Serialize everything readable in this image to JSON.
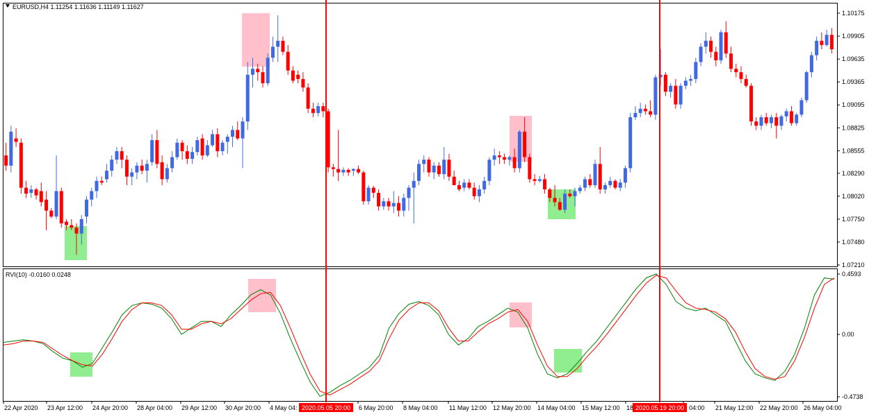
{
  "colors": {
    "bull": "#4169e1",
    "bear": "#ff0000",
    "rvi_main": "#008000",
    "rvi_signal": "#ff0000",
    "pink_box": "#ffc0cb",
    "green_box": "#90ee90",
    "vline": "#ff0000",
    "axis_highlight_bg": "#ff0000"
  },
  "main_pane": {
    "symbol_header": "EURUSD,H4  1.11254 1.11636 1.11149 1.11627",
    "header_icon": "dropdown-triangle-icon",
    "price_labels": [
      "1.10175",
      "1.09905",
      "1.09635",
      "1.09365",
      "1.09095",
      "1.08825",
      "1.08555",
      "1.08290",
      "1.08020",
      "1.07750",
      "1.07480",
      "1.07210"
    ]
  },
  "rvi_pane": {
    "header": "RVI(10) -0.0160 0.0248",
    "scale_labels": [
      "0.4593",
      "0.00",
      "-0.4738"
    ]
  },
  "time_axis": {
    "labels": [
      "22 Apr 2020",
      "23 Apr 12:00",
      "24 Apr 20:00",
      "28 Apr 04:00",
      "29 Apr 12:00",
      "30 Apr 20:00",
      "4 May 04:",
      "6 May 20:00",
      "8 May 04:00",
      "11 May 12:00",
      "12 May 20:00",
      "14 May 04:00",
      "15 May 12:00",
      "18",
      "y 04:00",
      "21 May 12:00",
      "22 May 20:00",
      "26 May 04:00"
    ],
    "highlight_1": "2020.05.05 20:00",
    "highlight_2": "2020.05.19 20:00"
  },
  "chart_data": [
    {
      "type": "candlestick",
      "symbol": "EURUSD",
      "timeframe": "H4",
      "ylim": [
        1.0721,
        1.10175
      ],
      "last_ohlc": {
        "open": 1.11254,
        "high": 1.11636,
        "low": 1.11149,
        "close": 1.11627
      },
      "candles": [
        [
          1.085,
          1.0865,
          1.0832,
          1.0838
        ],
        [
          1.0838,
          1.0885,
          1.083,
          1.0878
        ],
        [
          1.087,
          1.0882,
          1.086,
          1.0866
        ],
        [
          1.0865,
          1.087,
          1.0805,
          1.0812
        ],
        [
          1.0812,
          1.082,
          1.08,
          1.0805
        ],
        [
          1.0806,
          1.0815,
          1.08,
          1.081
        ],
        [
          1.081,
          1.0812,
          1.0798,
          1.0803
        ],
        [
          1.0808,
          1.0818,
          1.079,
          1.0795
        ],
        [
          1.0798,
          1.0808,
          1.0762,
          1.0785
        ],
        [
          1.0785,
          1.0788,
          1.0776,
          1.0778
        ],
        [
          1.0778,
          1.085,
          1.0775,
          1.0808
        ],
        [
          1.0808,
          1.0812,
          1.0765,
          1.077
        ],
        [
          1.0772,
          1.0775,
          1.0762,
          1.0768
        ],
        [
          1.0768,
          1.0775,
          1.0762,
          1.0765
        ],
        [
          1.0765,
          1.077,
          1.0733,
          1.0758
        ],
        [
          1.0758,
          1.078,
          1.0745,
          1.0775
        ],
        [
          1.0778,
          1.0802,
          1.077,
          1.0798
        ],
        [
          1.0798,
          1.0812,
          1.079,
          1.0808
        ],
        [
          1.0808,
          1.0825,
          1.08,
          1.082
        ],
        [
          1.082,
          1.0825,
          1.0815,
          1.0818
        ],
        [
          1.0822,
          1.084,
          1.0818,
          1.0832
        ],
        [
          1.0832,
          1.085,
          1.0825,
          1.0845
        ],
        [
          1.0845,
          1.086,
          1.084,
          1.0855
        ],
        [
          1.0855,
          1.086,
          1.0835,
          1.0845
        ],
        [
          1.0845,
          1.085,
          1.0815,
          1.0825
        ],
        [
          1.0825,
          1.0835,
          1.0815,
          1.083
        ],
        [
          1.083,
          1.0842,
          1.0822,
          1.0838
        ],
        [
          1.0838,
          1.0845,
          1.0828,
          1.0832
        ],
        [
          1.0832,
          1.0845,
          1.0818,
          1.084
        ],
        [
          1.0842,
          1.0875,
          1.0838,
          1.0868
        ],
        [
          1.0868,
          1.088,
          1.0835,
          1.084
        ],
        [
          1.0842,
          1.085,
          1.0815,
          1.0822
        ],
        [
          1.0822,
          1.084,
          1.0818,
          1.0835
        ],
        [
          1.0835,
          1.0855,
          1.083,
          1.0848
        ],
        [
          1.0848,
          1.087,
          1.0845,
          1.0865
        ],
        [
          1.0865,
          1.0868,
          1.0845,
          1.0855
        ],
        [
          1.0855,
          1.0862,
          1.084,
          1.0846
        ],
        [
          1.0846,
          1.086,
          1.084,
          1.0854
        ],
        [
          1.0854,
          1.0872,
          1.085,
          1.0868
        ],
        [
          1.087,
          1.0875,
          1.0845,
          1.085
        ],
        [
          1.085,
          1.0868,
          1.0848,
          1.0862
        ],
        [
          1.0862,
          1.088,
          1.086,
          1.0875
        ],
        [
          1.0875,
          1.0882,
          1.0848,
          1.0855
        ],
        [
          1.0855,
          1.0868,
          1.085,
          1.0865
        ],
        [
          1.0866,
          1.0875,
          1.0852,
          1.0872
        ],
        [
          1.0872,
          1.0885,
          1.086,
          1.088
        ],
        [
          1.088,
          1.089,
          1.0868,
          1.087
        ],
        [
          1.087,
          1.0895,
          1.0835,
          1.089
        ],
        [
          1.089,
          1.096,
          1.088,
          1.0945
        ],
        [
          1.0945,
          1.0965,
          1.093,
          1.0952
        ],
        [
          1.0952,
          1.0958,
          1.0938,
          1.0948
        ],
        [
          1.0948,
          1.0955,
          1.093,
          1.0935
        ],
        [
          1.0935,
          1.097,
          1.0932,
          1.0965
        ],
        [
          1.0965,
          1.099,
          1.096,
          1.0978
        ],
        [
          1.0978,
          1.1015,
          1.096,
          1.0985
        ],
        [
          1.0985,
          1.099,
          1.0968,
          1.0972
        ],
        [
          1.0972,
          1.098,
          1.0945,
          1.095
        ],
        [
          1.095,
          1.0955,
          1.0935,
          1.0938
        ],
        [
          1.0945,
          1.095,
          1.0935,
          1.094
        ],
        [
          1.094,
          1.0948,
          1.0925,
          1.093
        ],
        [
          1.093,
          1.0935,
          1.09,
          1.0905
        ],
        [
          1.0905,
          1.0912,
          1.0895,
          1.09
        ],
        [
          1.09,
          1.0912,
          1.0896,
          1.0908
        ],
        [
          1.0908,
          1.0912,
          1.0895,
          1.0902
        ],
        [
          1.0902,
          1.0905,
          1.083,
          1.0836
        ],
        [
          1.0836,
          1.084,
          1.0825,
          1.0834
        ],
        [
          1.0834,
          1.088,
          1.082,
          1.083
        ],
        [
          1.083,
          1.0836,
          1.0826,
          1.0833
        ],
        [
          1.0833,
          1.0835,
          1.0826,
          1.083
        ],
        [
          1.0832,
          1.0835,
          1.0826,
          1.0834
        ],
        [
          1.0834,
          1.0838,
          1.0828,
          1.083
        ],
        [
          1.083,
          1.0832,
          1.0792,
          1.0796
        ],
        [
          1.0796,
          1.0815,
          1.0792,
          1.0812
        ],
        [
          1.0812,
          1.0814,
          1.08,
          1.0806
        ],
        [
          1.0806,
          1.081,
          1.0785,
          1.079
        ],
        [
          1.079,
          1.08,
          1.0786,
          1.0796
        ],
        [
          1.0796,
          1.08,
          1.0785,
          1.079
        ],
        [
          1.079,
          1.0808,
          1.0782,
          1.0794
        ],
        [
          1.0794,
          1.0802,
          1.0778,
          1.0785
        ],
        [
          1.0785,
          1.0805,
          1.0778,
          1.08
        ],
        [
          1.08,
          1.0815,
          1.0785,
          1.0812
        ],
        [
          1.0812,
          1.083,
          1.077,
          1.082
        ],
        [
          1.082,
          1.0845,
          1.0815,
          1.084
        ],
        [
          1.084,
          1.085,
          1.083,
          1.0845
        ],
        [
          1.0845,
          1.0848,
          1.0825,
          1.083
        ],
        [
          1.083,
          1.0842,
          1.0822,
          1.0838
        ],
        [
          1.0838,
          1.0842,
          1.0825,
          1.0828
        ],
        [
          1.0828,
          1.086,
          1.0822,
          1.0845
        ],
        [
          1.0845,
          1.0852,
          1.082,
          1.0825
        ],
        [
          1.0825,
          1.0832,
          1.0815,
          1.0815
        ],
        [
          1.0815,
          1.082,
          1.0808,
          1.081
        ],
        [
          1.0812,
          1.0822,
          1.0808,
          1.0818
        ],
        [
          1.0818,
          1.0822,
          1.081,
          1.0812
        ],
        [
          1.0812,
          1.0818,
          1.0798,
          1.0802
        ],
        [
          1.0802,
          1.0815,
          1.0795,
          1.081
        ],
        [
          1.081,
          1.0825,
          1.0805,
          1.082
        ],
        [
          1.082,
          1.0848,
          1.0815,
          1.0845
        ],
        [
          1.0845,
          1.0858,
          1.0838,
          1.085
        ],
        [
          1.085,
          1.0855,
          1.084,
          1.0848
        ],
        [
          1.0848,
          1.0852,
          1.084,
          1.0845
        ],
        [
          1.0845,
          1.085,
          1.0838,
          1.0848
        ],
        [
          1.0848,
          1.0858,
          1.083,
          1.0835
        ],
        [
          1.0835,
          1.088,
          1.083,
          1.0878
        ],
        [
          1.0878,
          1.0895,
          1.0842,
          1.0848
        ],
        [
          1.0848,
          1.0852,
          1.0818,
          1.0822
        ],
        [
          1.0822,
          1.0828,
          1.0815,
          1.082
        ],
        [
          1.082,
          1.0826,
          1.0818,
          1.0822
        ],
        [
          1.0822,
          1.0828,
          1.0805,
          1.081
        ],
        [
          1.081,
          1.0812,
          1.0795,
          1.08
        ],
        [
          1.08,
          1.0815,
          1.079,
          1.0795
        ],
        [
          1.0795,
          1.08,
          1.0785,
          1.0786
        ],
        [
          1.0786,
          1.081,
          1.0782,
          1.0805
        ],
        [
          1.0805,
          1.081,
          1.08,
          1.0802
        ],
        [
          1.0802,
          1.0812,
          1.079,
          1.0808
        ],
        [
          1.0808,
          1.0815,
          1.0805,
          1.0812
        ],
        [
          1.0812,
          1.0825,
          1.0808,
          1.0822
        ],
        [
          1.0822,
          1.0828,
          1.0812,
          1.0815
        ],
        [
          1.0815,
          1.0845,
          1.0812,
          1.084
        ],
        [
          1.084,
          1.086,
          1.0805,
          1.081
        ],
        [
          1.081,
          1.0818,
          1.0805,
          1.0815
        ],
        [
          1.0815,
          1.0825,
          1.0812,
          1.082
        ],
        [
          1.082,
          1.0822,
          1.081,
          1.0812
        ],
        [
          1.0812,
          1.0822,
          1.0808,
          1.0818
        ],
        [
          1.0818,
          1.0838,
          1.0812,
          1.0835
        ],
        [
          1.0835,
          1.09,
          1.083,
          1.0895
        ],
        [
          1.0895,
          1.0908,
          1.0892,
          1.09
        ],
        [
          1.09,
          1.0912,
          1.0895,
          1.0905
        ],
        [
          1.0905,
          1.091,
          1.0898,
          1.0902
        ],
        [
          1.0902,
          1.0915,
          1.0895,
          1.0898
        ],
        [
          1.0898,
          1.0945,
          1.0892,
          1.0942
        ],
        [
          1.0942,
          1.0975,
          1.0932,
          1.0945
        ],
        [
          1.0945,
          1.0948,
          1.092,
          1.0925
        ],
        [
          1.0925,
          1.0935,
          1.0918,
          1.0932
        ],
        [
          1.0932,
          1.094,
          1.0905,
          1.091
        ],
        [
          1.091,
          1.0935,
          1.0905,
          1.0932
        ],
        [
          1.0932,
          1.0942,
          1.0928,
          1.0938
        ],
        [
          1.0938,
          1.0945,
          1.0932,
          1.094
        ],
        [
          1.094,
          1.0965,
          1.0935,
          1.096
        ],
        [
          1.096,
          1.0982,
          1.0955,
          1.0978
        ],
        [
          1.0978,
          1.0995,
          1.097,
          1.0985
        ],
        [
          1.0985,
          1.099,
          1.0965,
          1.0972
        ],
        [
          1.0972,
          1.0978,
          1.0955,
          1.0962
        ],
        [
          1.0962,
          1.0998,
          1.0958,
          1.0995
        ],
        [
          1.0995,
          1.1008,
          1.0965,
          1.097
        ],
        [
          1.097,
          1.0978,
          1.0948,
          1.0952
        ],
        [
          1.0952,
          1.0958,
          1.0942,
          1.0948
        ],
        [
          1.0948,
          1.0955,
          1.0935,
          1.094
        ],
        [
          1.094,
          1.0945,
          1.093,
          1.0932
        ],
        [
          1.0932,
          1.0935,
          1.0885,
          1.089
        ],
        [
          1.089,
          1.0895,
          1.088,
          1.0885
        ],
        [
          1.0885,
          1.0898,
          1.088,
          1.0895
        ],
        [
          1.0895,
          1.09,
          1.0885,
          1.0888
        ],
        [
          1.0888,
          1.0898,
          1.0882,
          1.0895
        ],
        [
          1.0895,
          1.09,
          1.087,
          1.0885
        ],
        [
          1.0885,
          1.0898,
          1.088,
          1.0896
        ],
        [
          1.0896,
          1.0905,
          1.089,
          1.0902
        ],
        [
          1.0902,
          1.0908,
          1.0885,
          1.0888
        ],
        [
          1.0888,
          1.09,
          1.0885,
          1.0898
        ],
        [
          1.0898,
          1.0918,
          1.0895,
          1.0915
        ],
        [
          1.0915,
          1.095,
          1.0912,
          1.0948
        ],
        [
          1.0948,
          1.0972,
          1.0942,
          1.0968
        ],
        [
          1.0968,
          1.099,
          1.0962,
          1.0985
        ],
        [
          1.0985,
          1.0995,
          1.0975,
          1.098
        ],
        [
          1.098,
          1.0998,
          1.0978,
          1.0992
        ],
        [
          1.0992,
          1.1,
          1.097,
          1.0975
        ]
      ]
    },
    {
      "type": "line",
      "title": "RVI(10)",
      "ylim": [
        -0.4738,
        0.4593
      ],
      "series": [
        {
          "name": "-0.0160",
          "values": [
            -0.06,
            -0.05,
            -0.04,
            -0.05,
            -0.07,
            -0.13,
            -0.18,
            -0.2,
            -0.25,
            -0.22,
            -0.1,
            0.02,
            0.15,
            0.22,
            0.24,
            0.23,
            0.2,
            0.12,
            0.0,
            0.05,
            0.1,
            0.1,
            0.06,
            0.15,
            0.22,
            0.3,
            0.34,
            0.3,
            0.16,
            -0.03,
            -0.2,
            -0.36,
            -0.47,
            -0.44,
            -0.39,
            -0.35,
            -0.3,
            -0.25,
            -0.16,
            0.05,
            0.16,
            0.23,
            0.25,
            0.22,
            0.15,
            0.0,
            -0.08,
            -0.03,
            0.06,
            0.1,
            0.15,
            0.2,
            0.17,
            0.05,
            -0.15,
            -0.3,
            -0.33,
            -0.3,
            -0.22,
            -0.13,
            -0.05,
            0.05,
            0.15,
            0.25,
            0.35,
            0.43,
            0.46,
            0.38,
            0.25,
            0.2,
            0.18,
            0.2,
            0.15,
            0.1,
            -0.05,
            -0.2,
            -0.3,
            -0.33,
            -0.35,
            -0.28,
            -0.15,
            0.05,
            0.3,
            0.43,
            0.42
          ]
        },
        {
          "name": "0.0248",
          "values": [
            -0.08,
            -0.07,
            -0.05,
            -0.05,
            -0.06,
            -0.11,
            -0.16,
            -0.2,
            -0.23,
            -0.24,
            -0.15,
            -0.03,
            0.1,
            0.19,
            0.24,
            0.24,
            0.22,
            0.15,
            0.04,
            0.04,
            0.08,
            0.1,
            0.08,
            0.12,
            0.19,
            0.26,
            0.31,
            0.32,
            0.22,
            0.05,
            -0.13,
            -0.3,
            -0.43,
            -0.46,
            -0.42,
            -0.38,
            -0.33,
            -0.28,
            -0.2,
            -0.03,
            0.11,
            0.19,
            0.24,
            0.24,
            0.18,
            0.05,
            -0.05,
            -0.05,
            0.02,
            0.08,
            0.12,
            0.17,
            0.19,
            0.1,
            -0.08,
            -0.24,
            -0.32,
            -0.32,
            -0.26,
            -0.17,
            -0.09,
            0.0,
            0.1,
            0.2,
            0.3,
            0.39,
            0.45,
            0.43,
            0.33,
            0.24,
            0.2,
            0.19,
            0.17,
            0.12,
            0.02,
            -0.13,
            -0.26,
            -0.32,
            -0.34,
            -0.32,
            -0.2,
            -0.02,
            0.2,
            0.38,
            0.43
          ]
        }
      ]
    }
  ]
}
